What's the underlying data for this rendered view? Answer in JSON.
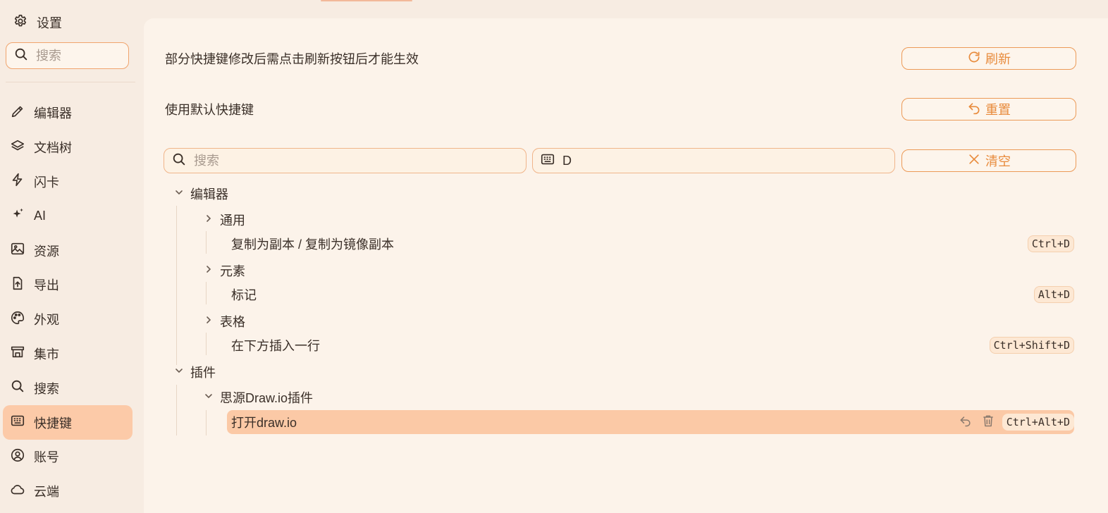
{
  "sidebar": {
    "title": "设置",
    "search_placeholder": "搜索",
    "items": [
      {
        "label": "编辑器",
        "icon": "pencil-icon"
      },
      {
        "label": "文档树",
        "icon": "layers-icon"
      },
      {
        "label": "闪卡",
        "icon": "lightning-icon"
      },
      {
        "label": "AI",
        "icon": "sparkle-icon"
      },
      {
        "label": "资源",
        "icon": "image-icon"
      },
      {
        "label": "导出",
        "icon": "export-icon"
      },
      {
        "label": "外观",
        "icon": "palette-icon"
      },
      {
        "label": "集市",
        "icon": "store-icon"
      },
      {
        "label": "搜索",
        "icon": "search-icon"
      },
      {
        "label": "快捷键",
        "icon": "keyboard-icon",
        "active": true
      },
      {
        "label": "账号",
        "icon": "account-icon"
      },
      {
        "label": "云端",
        "icon": "cloud-icon"
      }
    ]
  },
  "main": {
    "refresh_hint": "部分快捷键修改后需点击刷新按钮后才能生效",
    "refresh_button": "刷新",
    "reset_hint": "使用默认快捷键",
    "reset_button": "重置",
    "search_placeholder": "搜索",
    "key_filter_value": "D",
    "clear_button": "清空",
    "tree": {
      "editor_group": "编辑器",
      "general_group": "通用",
      "duplicate_label": "复制为副本 / 复制为镜像副本",
      "duplicate_key": "Ctrl+D",
      "element_group": "元素",
      "mark_label": "标记",
      "mark_key": "Alt+D",
      "table_group": "表格",
      "insert_row_label": "在下方插入一行",
      "insert_row_key": "Ctrl+Shift+D",
      "plugins_group": "插件",
      "drawio_group": "思源Draw.io插件",
      "open_drawio_label": "打开draw.io",
      "open_drawio_key": "Ctrl+Alt+D"
    }
  },
  "colors": {
    "accent": "#e88b3c",
    "active_bg": "#fccaa8",
    "panel_bg": "#fcf3ea",
    "page_bg": "#f7ece2"
  }
}
